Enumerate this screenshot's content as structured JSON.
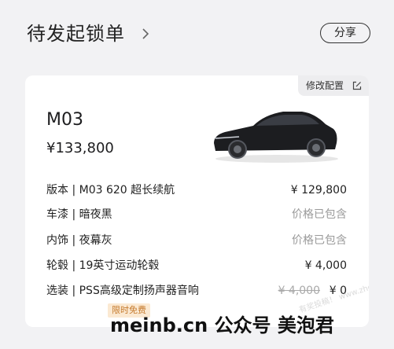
{
  "header": {
    "title": "待发起锁单",
    "share_label": "分享"
  },
  "card": {
    "modify_label": "修改配置",
    "model_name": "M03",
    "model_price": "¥133,800",
    "rows": [
      {
        "label": "版本 | M03 620 超长续航",
        "value": "¥ 129,800",
        "muted": false
      },
      {
        "label": "车漆 | 暗夜黑",
        "value": "价格已包含",
        "muted": true
      },
      {
        "label": "内饰 | 夜幕灰",
        "value": "价格已包含",
        "muted": true
      },
      {
        "label": "轮毂 | 19英寸运动轮毂",
        "value": "¥ 4,000",
        "muted": false
      },
      {
        "label": "选装 | PSS高级定制扬声器音响",
        "value": "¥ 0",
        "old_price": "¥ 4,000",
        "muted": false
      }
    ],
    "free_tag": "限时免费"
  },
  "watermark": {
    "small": "有奖投稿！ www.zhe8.com",
    "large": "meinb.cn 公众号 美泡君"
  },
  "colors": {
    "background": "#f2f2f4",
    "card": "#ffffff",
    "tag_bg": "#fbe9d2",
    "tag_text": "#c57a2d"
  }
}
